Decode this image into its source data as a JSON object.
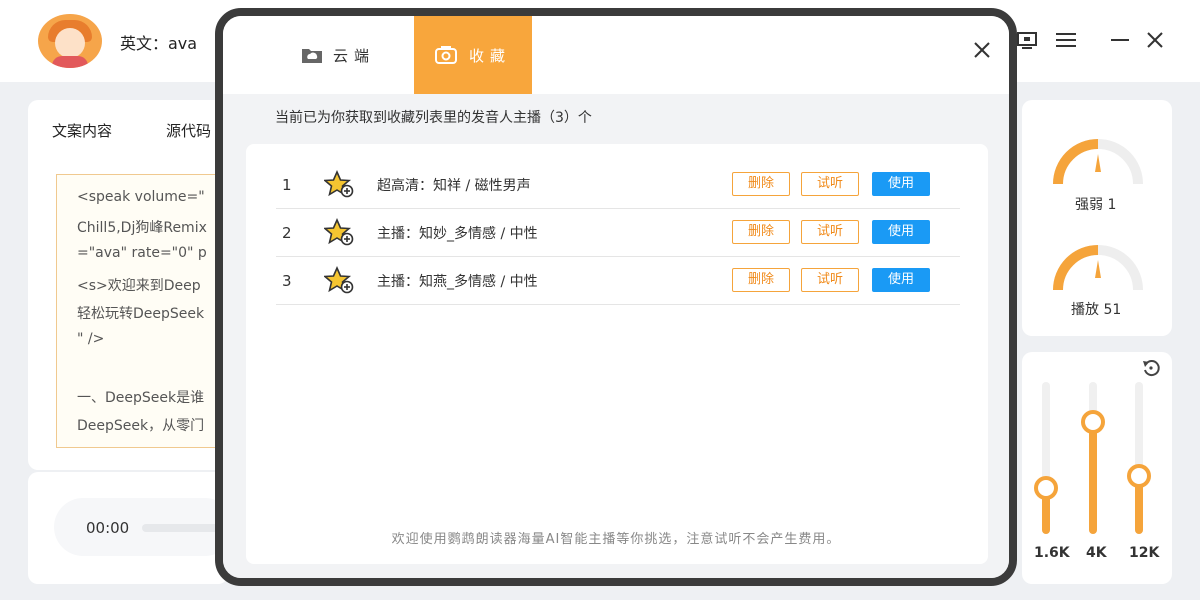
{
  "app": {
    "voice_label": "英文：ava",
    "left_tabs": [
      "文案内容",
      "源代码"
    ],
    "doc_lines": [
      "<speak volume=\"",
      "Chill5,Dj狗峰Remix",
      "=\"ava\" rate=\"0\" p",
      "  <s>欢迎来到Deep",
      "轻松玩转DeepSeek",
      "\" />",
      "",
      "一、DeepSeek是谁",
      "DeepSeek，从零门"
    ],
    "player_time": "00:00",
    "gauges": [
      {
        "label": "强弱 1",
        "level": 0.1
      },
      {
        "label": "播放 51",
        "level": 0.51
      }
    ],
    "eq": [
      {
        "label": "1.6K",
        "level": 0.35
      },
      {
        "label": "4K",
        "level": 0.85
      },
      {
        "label": "12K",
        "level": 0.4
      }
    ],
    "reset_icon": "reset-icon"
  },
  "modal": {
    "tabs": [
      {
        "label": "云端",
        "icon": "cloud-folder-icon",
        "active": false
      },
      {
        "label": "收藏",
        "icon": "favorite-box-icon",
        "active": true
      }
    ],
    "summary": "当前已为你获取到收藏列表里的发音人主播（3）个",
    "rows": [
      {
        "num": "1",
        "name": "超高清：知祥 / 磁性男声"
      },
      {
        "num": "2",
        "name": "主播：知妙_多情感 / 中性"
      },
      {
        "num": "3",
        "name": "主播：知燕_多情感 / 中性"
      }
    ],
    "buttons": {
      "delete": "删除",
      "listen": "试听",
      "use": "使用"
    },
    "footer": "欢迎使用鹦鹉朗读器海量AI智能主播等你挑选，注意试听不会产生费用。"
  },
  "colors": {
    "accent": "#f8a63c",
    "primary": "#1a9af5"
  }
}
